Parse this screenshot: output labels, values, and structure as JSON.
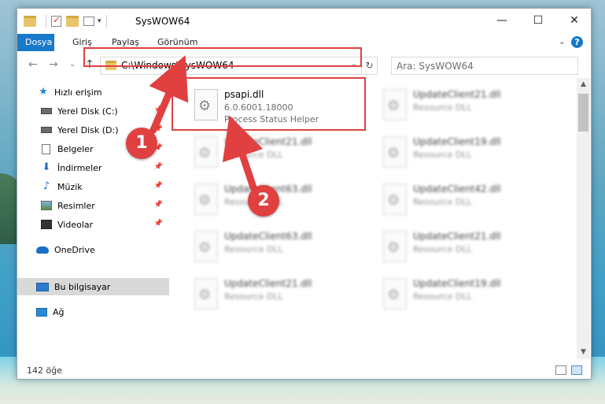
{
  "titlebar": {
    "title": "SysWOW64",
    "minimize": "—",
    "maximize": "☐",
    "close": "✕"
  },
  "ribbon": {
    "tabs": [
      {
        "label": "Dosya",
        "active": true
      },
      {
        "label": "Giriş"
      },
      {
        "label": "Paylaş"
      },
      {
        "label": "Görünüm"
      }
    ],
    "help": "?",
    "collapse": "⌄"
  },
  "nav": {
    "back": "←",
    "forward": "→",
    "recent": "⌄",
    "up": "↑",
    "address": "C:\\Windows\\SysWOW64",
    "address_drop": "⌄",
    "refresh": "↻",
    "search_placeholder": "Ara: SysWOW64"
  },
  "sidebar": {
    "items": [
      {
        "label": "Hızlı erişim",
        "icon": "star-icon"
      },
      {
        "label": "Yerel Disk (C:)",
        "icon": "disk-icon",
        "pinned": true
      },
      {
        "label": "Yerel Disk (D:)",
        "icon": "disk-icon",
        "pinned": true
      },
      {
        "label": "Belgeler",
        "icon": "documents-icon",
        "pinned": true
      },
      {
        "label": "İndirmeler",
        "icon": "download-icon",
        "pinned": true
      },
      {
        "label": "Müzik",
        "icon": "music-icon",
        "pinned": true
      },
      {
        "label": "Resimler",
        "icon": "pictures-icon",
        "pinned": true
      },
      {
        "label": "Videolar",
        "icon": "videos-icon",
        "pinned": true
      },
      {
        "label": "OneDrive",
        "icon": "onedrive-icon"
      },
      {
        "label": "Bu bilgisayar",
        "icon": "computer-icon",
        "selected": true
      },
      {
        "label": "Ağ",
        "icon": "network-icon"
      }
    ]
  },
  "files": [
    {
      "name": "psapi.dll",
      "version": "6.0.6001.18000",
      "desc": "Process Status Helper"
    },
    {
      "name": "UpdateClient21.dll",
      "desc": "Resource DLL"
    },
    {
      "name": "UpdateClient21.dll",
      "desc": "Resource DLL"
    },
    {
      "name": "UpdateClient19.dll",
      "desc": "Resource DLL"
    },
    {
      "name": "UpdateClient63.dll",
      "desc": "Resource DLL"
    },
    {
      "name": "UpdateClient42.dll",
      "desc": "Resource DLL"
    },
    {
      "name": "UpdateClient63.dll",
      "desc": "Resource DLL"
    },
    {
      "name": "UpdateClient21.dll",
      "desc": "Resource DLL"
    },
    {
      "name": "UpdateClient21.dll",
      "desc": "Resource DLL"
    },
    {
      "name": "UpdateClient19.dll",
      "desc": "Resource DLL"
    }
  ],
  "status": {
    "count": "142 öğe"
  },
  "annotations": {
    "step1": "1",
    "step2": "2",
    "highlight_color": "#e04040"
  }
}
